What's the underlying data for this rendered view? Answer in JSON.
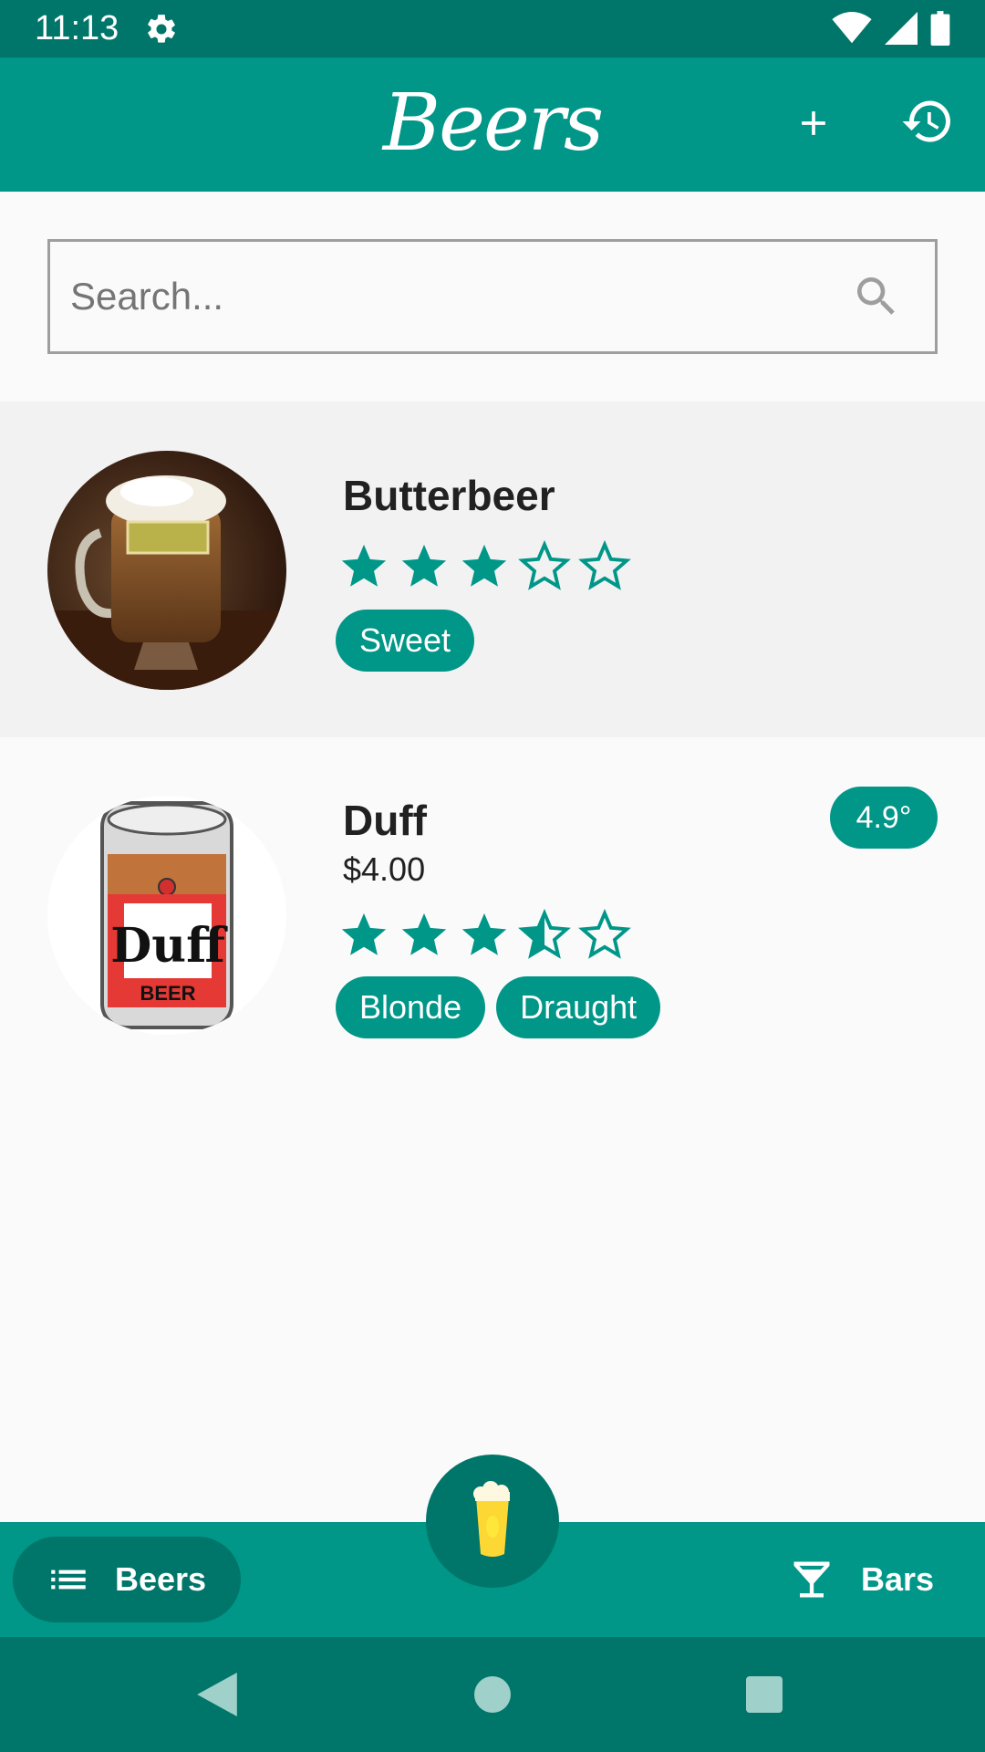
{
  "status_bar": {
    "time": "11:13"
  },
  "app_bar": {
    "title": "Beers"
  },
  "search": {
    "placeholder": "Search..."
  },
  "beers": [
    {
      "name": "Butterbeer",
      "rating": 3,
      "tags": [
        "Sweet"
      ]
    },
    {
      "name": "Duff",
      "price": "$4.00",
      "rating": 3.5,
      "abv": "4.9°",
      "tags": [
        "Blonde",
        "Draught"
      ]
    }
  ],
  "bottom_nav": {
    "beers_label": "Beers",
    "bars_label": "Bars"
  },
  "colors": {
    "primary": "#009688",
    "primary_dark": "#00766a",
    "background": "#fafafa"
  },
  "icons": [
    "settings-icon",
    "wifi-icon",
    "signal-icon",
    "battery-icon",
    "add-icon",
    "history-icon",
    "search-icon",
    "star-icon",
    "list-icon",
    "cocktail-icon",
    "beer-glass-icon",
    "back-icon",
    "home-icon",
    "recents-icon"
  ]
}
